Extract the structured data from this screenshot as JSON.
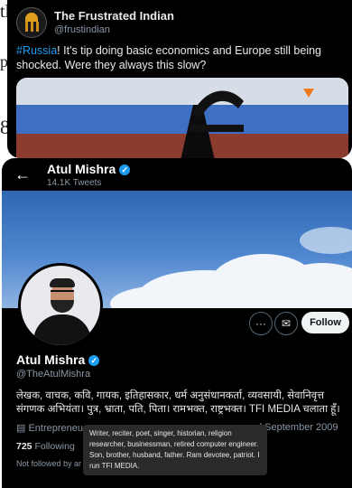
{
  "background": {
    "frag1": "tl",
    "frag2": "p",
    "frag3": "8"
  },
  "tweet_card": {
    "account_name": "The Frustrated Indian",
    "handle": "@frustindian",
    "hashtag": "#Russia",
    "text": "! It's tip doing basic economics and Europe still being shocked. Were they always this slow?"
  },
  "profile_header": {
    "back_arrow": "←",
    "name": "Atul Mishra",
    "tweets": "14.1K Tweets",
    "verified_glyph": "✓"
  },
  "profile": {
    "name": "Atul Mishra",
    "handle": "@TheAtulMishra",
    "bio": "लेखक, वाचक, कवि, गायक, इतिहासकार, धर्म अनुसंधानकर्ता, व्यवसायी, सेवानिवृत्त संगणक अभियंता। पुत्र, भ्राता, पति, पिता। रामभक्त, राष्ट्रभक्त। TFI MEDIA चलाता हूँ।",
    "occupation": "Entrepreneu",
    "joined": "d September 2009",
    "following_count": "725",
    "following_label": "Following",
    "not_followed": "Not followed by ar",
    "buttons": {
      "more_glyph": "···",
      "message_glyph": "✉",
      "follow_label": "Follow"
    }
  },
  "tooltip": {
    "text": "Writer, reciter, poet, singer, historian, religion researcher, businessman, retired computer engineer. Son, brother, husband, father. Ram devotee, patriot. I run TFI MEDIA."
  },
  "colors": {
    "accent": "#1d9bf0",
    "card_bg": "#000000",
    "muted": "#8b98a5"
  },
  "icons": [
    "back-arrow-icon",
    "verified-badge-icon",
    "more-icon",
    "message-icon",
    "briefcase-icon",
    "logo-icon"
  ]
}
